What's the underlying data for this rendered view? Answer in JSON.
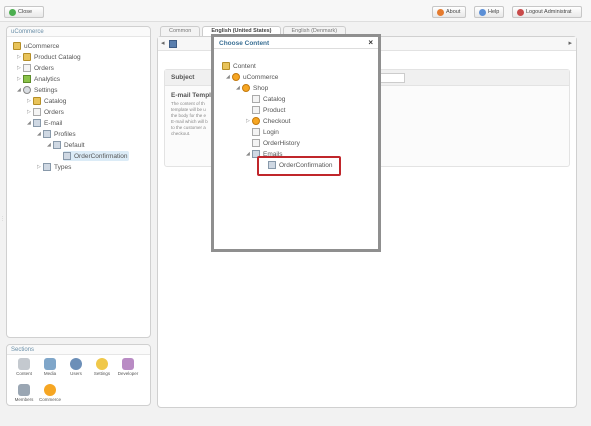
{
  "topbar": {
    "close_label": "Close",
    "about_label": "About",
    "help_label": "Help",
    "logout_label": "Logout Administrat"
  },
  "left_panel": {
    "title": "uCommerce",
    "tree": [
      "uCommerce",
      "Product Catalog",
      "Orders",
      "Analytics",
      "Settings",
      "Catalog",
      "Orders",
      "E-mail",
      "Profiles",
      "Default",
      "OrderConfirmation",
      "Types"
    ]
  },
  "sections": {
    "title": "Sections",
    "items": [
      "Content",
      "Media",
      "Users",
      "Settings",
      "Developer",
      "Members",
      "Commerce"
    ]
  },
  "editor": {
    "tabs": [
      "Common",
      "English (United States)",
      "English (Denmark)"
    ],
    "subject_label": "Subject",
    "template_heading": "E-mail Templa",
    "template_desc_lines": [
      "The content of th",
      "template will be u",
      "the body for the e",
      "E-mail which will b",
      "to the customer a",
      "checkout."
    ]
  },
  "modal": {
    "title": "Choose Content",
    "close": "×",
    "tree": [
      "Content",
      "uCommerce",
      "Shop",
      "Catalog",
      "Product",
      "Checkout",
      "Login",
      "OrderHistory",
      "Emails",
      "OrderConfirmation"
    ]
  }
}
